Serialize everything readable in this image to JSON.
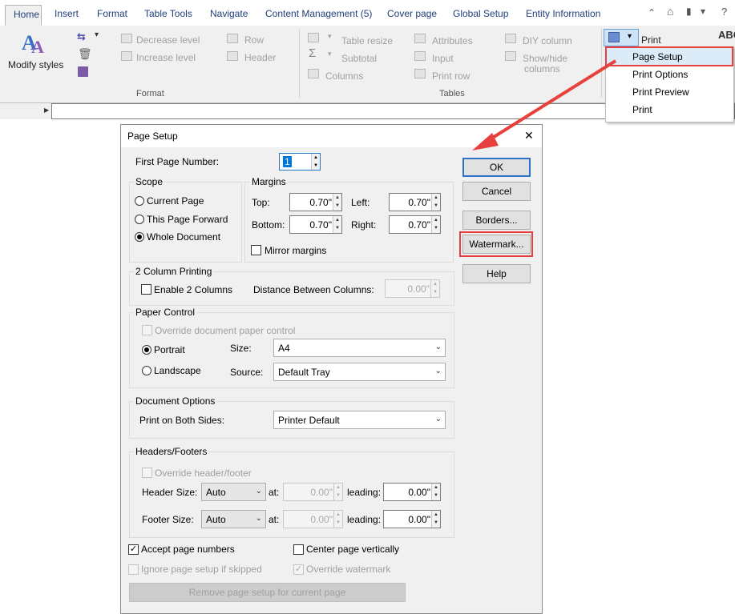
{
  "tabs": [
    "Home",
    "Insert",
    "Format",
    "Table Tools",
    "Navigate",
    "Content Management (5)",
    "Cover page",
    "Global Setup",
    "Entity Information"
  ],
  "quick_access": {
    "up": "⌃",
    "home": "⌂",
    "bookmark": "▮",
    "more": "▾"
  },
  "ribbon": {
    "modify_styles": "Modify styles",
    "decrease_level": "Decrease level",
    "increase_level": "Increase level",
    "row": "Row",
    "header": "Header",
    "table_resize": "Table resize",
    "subtotal": "Subtotal",
    "columns": "Columns",
    "attributes": "Attributes",
    "input": "Input",
    "print_row": "Print row",
    "diy_column": "DIY column",
    "show_hide_columns_1": "Show/hide",
    "show_hide_columns_2": "columns",
    "print": "Print",
    "abc": "ABC",
    "group_format": "Format",
    "group_tables": "Tables"
  },
  "print_menu": [
    "Page Setup",
    "Print Options",
    "Print Preview",
    "Print"
  ],
  "dialog": {
    "title": "Page Setup",
    "close": "✕",
    "first_page_number_label": "First Page Number:",
    "first_page_number_value": "1",
    "scope": {
      "title": "Scope",
      "options": [
        "Current Page",
        "This Page Forward",
        "Whole Document"
      ],
      "selected": 2
    },
    "margins": {
      "title": "Margins",
      "top_label": "Top:",
      "top": "0.70\"",
      "left_label": "Left:",
      "left": "0.70\"",
      "bottom_label": "Bottom:",
      "bottom": "0.70\"",
      "right_label": "Right:",
      "right": "0.70\"",
      "mirror": "Mirror margins"
    },
    "two_col": {
      "title": "2 Column Printing",
      "enable": "Enable 2 Columns",
      "distance_label": "Distance Between Columns:",
      "distance": "0.00\""
    },
    "paper": {
      "title": "Paper Control",
      "override": "Override document paper control",
      "portrait": "Portrait",
      "landscape": "Landscape",
      "size_label": "Size:",
      "size": "A4",
      "source_label": "Source:",
      "source": "Default Tray"
    },
    "doc_options": {
      "title": "Document Options",
      "both_sides_label": "Print on Both Sides:",
      "both_sides": "Printer Default"
    },
    "headers": {
      "title": "Headers/Footers",
      "override": "Override header/footer",
      "header_size_label": "Header Size:",
      "header_size": "Auto",
      "footer_size_label": "Footer Size:",
      "footer_size": "Auto",
      "at_label": "at:",
      "header_at": "0.00\"",
      "footer_at": "0.00\"",
      "leading_label": "leading:",
      "header_leading": "0.00\"",
      "footer_leading": "0.00\""
    },
    "accept_page_numbers": "Accept page numbers",
    "center_vertically": "Center page vertically",
    "ignore_setup": "Ignore page setup if skipped",
    "override_watermark": "Override watermark",
    "remove_setup": "Remove page setup for current page",
    "buttons": {
      "ok": "OK",
      "cancel": "Cancel",
      "borders": "Borders...",
      "watermark": "Watermark...",
      "help": "Help"
    }
  },
  "colors": {
    "highlight": "#e8413d",
    "tab_text": "#1f3f7a"
  }
}
